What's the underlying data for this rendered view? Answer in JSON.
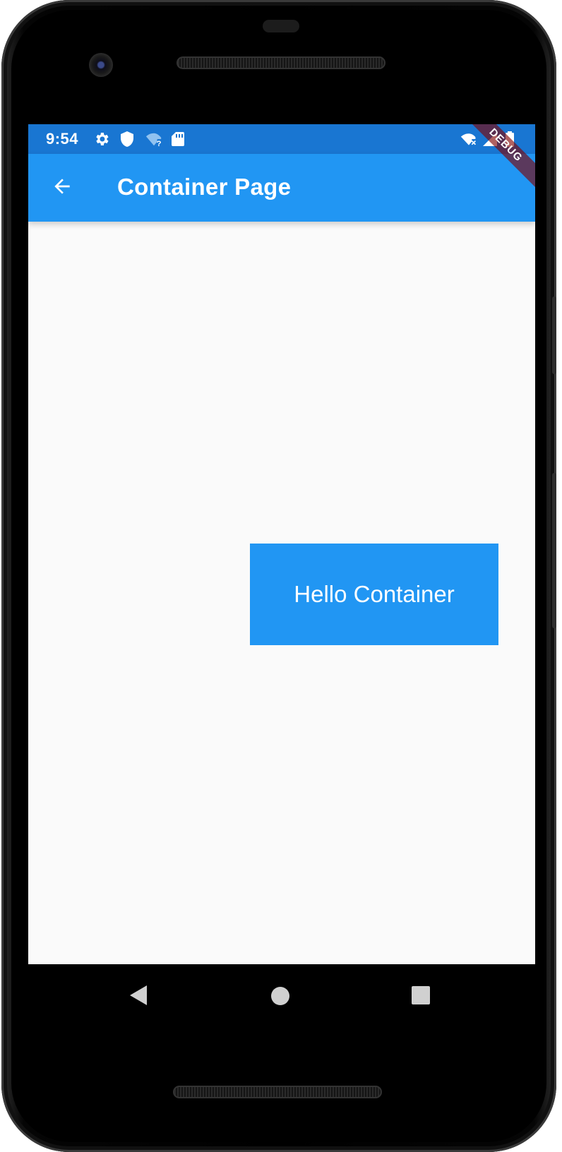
{
  "status_bar": {
    "time": "9:54",
    "icons": [
      "settings-icon",
      "shield-icon",
      "wifi-unknown-icon",
      "sd-card-icon",
      "wifi-off-icon",
      "signal-icon",
      "battery-icon"
    ]
  },
  "app_bar": {
    "title": "Container Page",
    "back_icon": "arrow-back-icon"
  },
  "debug_banner": "DEBUG",
  "content": {
    "container_text": "Hello Container"
  },
  "nav_bar": {
    "icons": [
      "back-triangle-icon",
      "home-circle-icon",
      "recents-square-icon"
    ]
  },
  "colors": {
    "status_bar": "#1976d2",
    "app_bar": "#2196f3",
    "container": "#2196f3",
    "background": "#fafafa",
    "debug_banner": "#800000"
  }
}
